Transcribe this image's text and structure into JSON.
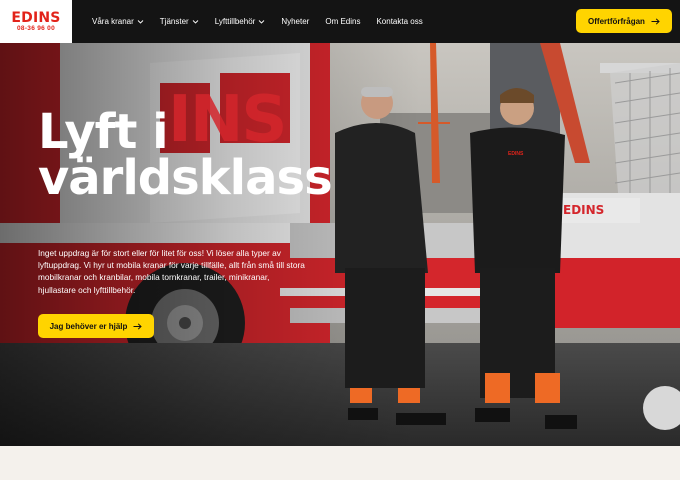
{
  "brand": {
    "name": "EDINS",
    "phone": "08-36 96 00",
    "color": "#e2231a"
  },
  "nav": {
    "items": [
      {
        "label": "Våra kranar",
        "has_dropdown": true
      },
      {
        "label": "Tjänster",
        "has_dropdown": true
      },
      {
        "label": "Lyfttillbehör",
        "has_dropdown": true
      },
      {
        "label": "Nyheter",
        "has_dropdown": false
      },
      {
        "label": "Om Edins",
        "has_dropdown": false
      },
      {
        "label": "Kontakta oss",
        "has_dropdown": false
      }
    ],
    "cta_label": "Offertförfrågan"
  },
  "hero": {
    "title_line1": "Lyft i",
    "title_line2": "världsklass",
    "body": "Inget uppdrag är för stort eller för litet för oss! Vi löser alla typer av lyftuppdrag. Vi hyr ut mobila kranar för varje tillfälle, allt från små till stora mobilkranar och kranbilar, mobila tornkranar, trailer, minikranar, hjullastare och lyfttillbehör.",
    "cta_label": "Jag behöver er hjälp",
    "truck_text_left": "INS",
    "truck_text_right": "EDINS",
    "shirt_text": "EDINS"
  },
  "colors": {
    "accent": "#ffd400",
    "header_bg": "#141414",
    "page_bg": "#f4f1ec"
  }
}
